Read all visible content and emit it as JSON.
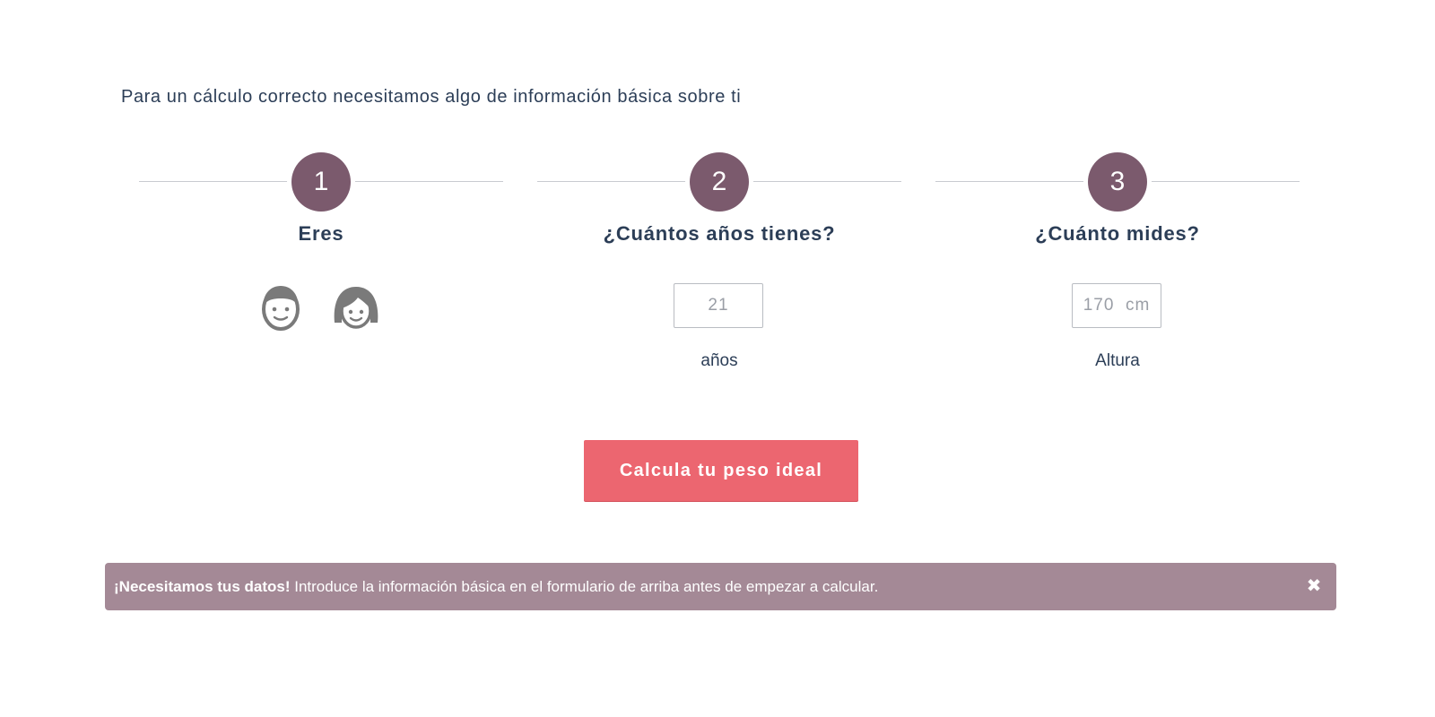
{
  "intro": {
    "text": "Para un cálculo correcto necesitamos algo de información básica sobre ti"
  },
  "steps": [
    {
      "number": "1",
      "title": "Eres"
    },
    {
      "number": "2",
      "title": "¿Cuántos años tienes?",
      "input_placeholder": "21",
      "label": "años"
    },
    {
      "number": "3",
      "title": "¿Cuánto mides?",
      "input_placeholder": "170  cm",
      "label": "Altura"
    }
  ],
  "gender": {
    "options": [
      "male-face-icon",
      "female-face-icon"
    ]
  },
  "calculate_button": {
    "label": "Calcula tu peso ideal"
  },
  "alert": {
    "strong": "¡Necesitamos tus datos!",
    "message": " Introduce la información básica en el formulario de arriba antes de empezar a calcular.",
    "close": "✖"
  },
  "colors": {
    "step_circle": "#7b5a6d",
    "button": "#ec6670",
    "alert_bg": "#a48996",
    "text": "#2c3e57"
  }
}
